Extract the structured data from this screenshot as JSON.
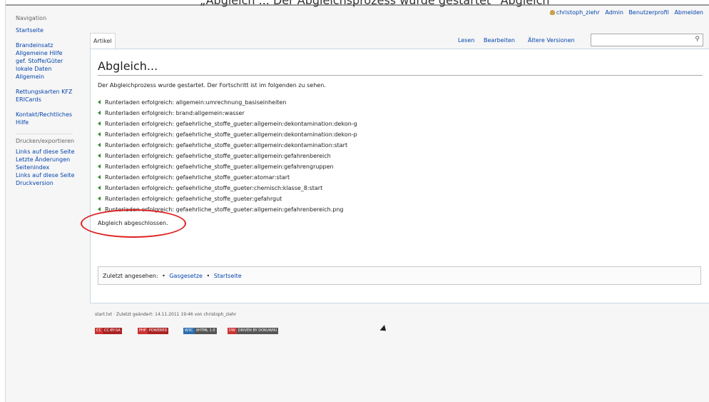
{
  "top_caption": "„Abgleich ... Der Abgleichsprozess wurde gestartet“ Abgleich",
  "personal_tools": {
    "user": "christoph_ziehr",
    "links": [
      "Admin",
      "Benutzerprofil",
      "Abmelden"
    ]
  },
  "sidebar": {
    "heading": "Navigation",
    "groups": [
      [
        "Startseite"
      ],
      [
        "Brandeinsatz",
        "Allgemeine Hilfe",
        "gef. Stoffe/Güter",
        "lokale Daten",
        "Allgemein"
      ],
      [
        "Rettungskarten KFZ",
        "ERICards"
      ],
      [
        "Kontakt/Rechtliches",
        "Hilfe"
      ]
    ],
    "print_heading": "Drucken/exportieren",
    "tool_links": [
      "Links auf diese Seite",
      "Letzte Änderungen",
      "Seitenindex",
      "Links auf diese Seite",
      "Druckversion"
    ]
  },
  "tabs": {
    "article": "Artikel",
    "read": "Lesen",
    "edit": "Bearbeiten",
    "history": "Ältere Versionen"
  },
  "search": {
    "placeholder": "",
    "icon": "magnifier-icon"
  },
  "main": {
    "title": "Abgleich...",
    "intro": "Der Abgleichprozess wurde gestartet. Der Fortschritt ist im folgenden zu sehen.",
    "downloads": [
      "Runterladen erfolgreich: allgemein:umrechnung_basiseinheiten",
      "Runterladen erfolgreich: brand:allgemein:wasser",
      "Runterladen erfolgreich: gefaehrliche_stoffe_gueter:allgemein:dekontamination:dekon-g",
      "Runterladen erfolgreich: gefaehrliche_stoffe_gueter:allgemein:dekontamination:dekon-p",
      "Runterladen erfolgreich: gefaehrliche_stoffe_gueter:allgemein:dekontamination:start",
      "Runterladen erfolgreich: gefaehrliche_stoffe_gueter:allgemein:gefahrenbereich",
      "Runterladen erfolgreich: gefaehrliche_stoffe_gueter:allgemein:gefahrengruppen",
      "Runterladen erfolgreich: gefaehrliche_stoffe_gueter:atomar:start",
      "Runterladen erfolgreich: gefaehrliche_stoffe_gueter:chemisch:klasse_8:start",
      "Runterladen erfolgreich: gefaehrliche_stoffe_gueter:gefahrgut",
      "Runterladen erfolgreich: gefaehrliche_stoffe_gueter:allgemein:gefahrenbereich.png"
    ],
    "done": "Abgleich abgeschlossen.",
    "breadcrumbs": {
      "label": "Zuletzt angesehen:",
      "items": [
        "Gasgesetze",
        "Startseite"
      ]
    }
  },
  "footer": {
    "info": "start.txt · Zuletzt geändert: 14.11.2011 19:46 von christoph_ziehr",
    "badges": [
      {
        "left": "CC",
        "right": "CC-BY-SA",
        "color_a": "#c33",
        "color_b": "#c33"
      },
      {
        "left": "PHP",
        "right": "POWERED",
        "color_a": "#c33",
        "color_b": "#c33"
      },
      {
        "left": "W3C",
        "right": "XHTML 1.0",
        "color_a": "#2a6fb0",
        "color_b": "#555"
      },
      {
        "left": "DW",
        "right": "DRIVEN BY DOKUWIKI",
        "color_a": "#c33",
        "color_b": "#555"
      }
    ]
  },
  "colors": {
    "link": "#0645ad",
    "highlight": "#e02020",
    "success_arrow": "#2e8b2e"
  }
}
